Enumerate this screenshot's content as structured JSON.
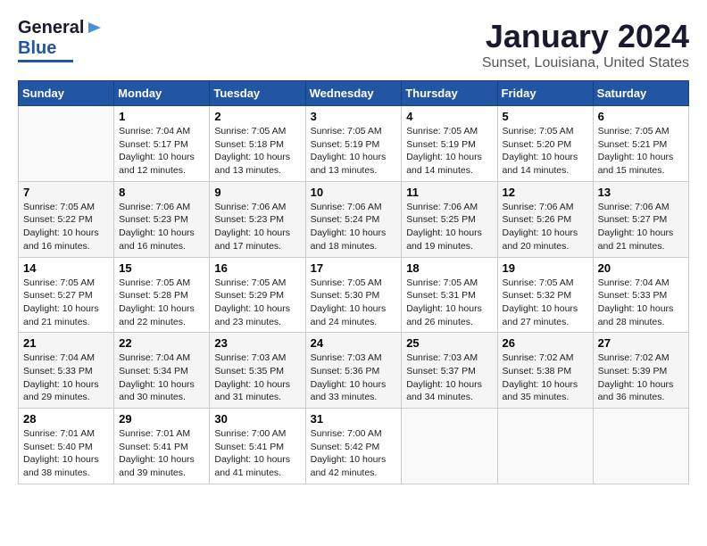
{
  "header": {
    "logo": {
      "line1": "General",
      "line2": "Blue"
    },
    "title": "January 2024",
    "subtitle": "Sunset, Louisiana, United States"
  },
  "weekdays": [
    "Sunday",
    "Monday",
    "Tuesday",
    "Wednesday",
    "Thursday",
    "Friday",
    "Saturday"
  ],
  "weeks": [
    [
      {
        "num": "",
        "sunrise": "",
        "sunset": "",
        "daylight": ""
      },
      {
        "num": "1",
        "sunrise": "Sunrise: 7:04 AM",
        "sunset": "Sunset: 5:17 PM",
        "daylight": "Daylight: 10 hours and 12 minutes."
      },
      {
        "num": "2",
        "sunrise": "Sunrise: 7:05 AM",
        "sunset": "Sunset: 5:18 PM",
        "daylight": "Daylight: 10 hours and 13 minutes."
      },
      {
        "num": "3",
        "sunrise": "Sunrise: 7:05 AM",
        "sunset": "Sunset: 5:19 PM",
        "daylight": "Daylight: 10 hours and 13 minutes."
      },
      {
        "num": "4",
        "sunrise": "Sunrise: 7:05 AM",
        "sunset": "Sunset: 5:19 PM",
        "daylight": "Daylight: 10 hours and 14 minutes."
      },
      {
        "num": "5",
        "sunrise": "Sunrise: 7:05 AM",
        "sunset": "Sunset: 5:20 PM",
        "daylight": "Daylight: 10 hours and 14 minutes."
      },
      {
        "num": "6",
        "sunrise": "Sunrise: 7:05 AM",
        "sunset": "Sunset: 5:21 PM",
        "daylight": "Daylight: 10 hours and 15 minutes."
      }
    ],
    [
      {
        "num": "7",
        "sunrise": "Sunrise: 7:05 AM",
        "sunset": "Sunset: 5:22 PM",
        "daylight": "Daylight: 10 hours and 16 minutes."
      },
      {
        "num": "8",
        "sunrise": "Sunrise: 7:06 AM",
        "sunset": "Sunset: 5:23 PM",
        "daylight": "Daylight: 10 hours and 16 minutes."
      },
      {
        "num": "9",
        "sunrise": "Sunrise: 7:06 AM",
        "sunset": "Sunset: 5:23 PM",
        "daylight": "Daylight: 10 hours and 17 minutes."
      },
      {
        "num": "10",
        "sunrise": "Sunrise: 7:06 AM",
        "sunset": "Sunset: 5:24 PM",
        "daylight": "Daylight: 10 hours and 18 minutes."
      },
      {
        "num": "11",
        "sunrise": "Sunrise: 7:06 AM",
        "sunset": "Sunset: 5:25 PM",
        "daylight": "Daylight: 10 hours and 19 minutes."
      },
      {
        "num": "12",
        "sunrise": "Sunrise: 7:06 AM",
        "sunset": "Sunset: 5:26 PM",
        "daylight": "Daylight: 10 hours and 20 minutes."
      },
      {
        "num": "13",
        "sunrise": "Sunrise: 7:06 AM",
        "sunset": "Sunset: 5:27 PM",
        "daylight": "Daylight: 10 hours and 21 minutes."
      }
    ],
    [
      {
        "num": "14",
        "sunrise": "Sunrise: 7:05 AM",
        "sunset": "Sunset: 5:27 PM",
        "daylight": "Daylight: 10 hours and 21 minutes."
      },
      {
        "num": "15",
        "sunrise": "Sunrise: 7:05 AM",
        "sunset": "Sunset: 5:28 PM",
        "daylight": "Daylight: 10 hours and 22 minutes."
      },
      {
        "num": "16",
        "sunrise": "Sunrise: 7:05 AM",
        "sunset": "Sunset: 5:29 PM",
        "daylight": "Daylight: 10 hours and 23 minutes."
      },
      {
        "num": "17",
        "sunrise": "Sunrise: 7:05 AM",
        "sunset": "Sunset: 5:30 PM",
        "daylight": "Daylight: 10 hours and 24 minutes."
      },
      {
        "num": "18",
        "sunrise": "Sunrise: 7:05 AM",
        "sunset": "Sunset: 5:31 PM",
        "daylight": "Daylight: 10 hours and 26 minutes."
      },
      {
        "num": "19",
        "sunrise": "Sunrise: 7:05 AM",
        "sunset": "Sunset: 5:32 PM",
        "daylight": "Daylight: 10 hours and 27 minutes."
      },
      {
        "num": "20",
        "sunrise": "Sunrise: 7:04 AM",
        "sunset": "Sunset: 5:33 PM",
        "daylight": "Daylight: 10 hours and 28 minutes."
      }
    ],
    [
      {
        "num": "21",
        "sunrise": "Sunrise: 7:04 AM",
        "sunset": "Sunset: 5:33 PM",
        "daylight": "Daylight: 10 hours and 29 minutes."
      },
      {
        "num": "22",
        "sunrise": "Sunrise: 7:04 AM",
        "sunset": "Sunset: 5:34 PM",
        "daylight": "Daylight: 10 hours and 30 minutes."
      },
      {
        "num": "23",
        "sunrise": "Sunrise: 7:03 AM",
        "sunset": "Sunset: 5:35 PM",
        "daylight": "Daylight: 10 hours and 31 minutes."
      },
      {
        "num": "24",
        "sunrise": "Sunrise: 7:03 AM",
        "sunset": "Sunset: 5:36 PM",
        "daylight": "Daylight: 10 hours and 33 minutes."
      },
      {
        "num": "25",
        "sunrise": "Sunrise: 7:03 AM",
        "sunset": "Sunset: 5:37 PM",
        "daylight": "Daylight: 10 hours and 34 minutes."
      },
      {
        "num": "26",
        "sunrise": "Sunrise: 7:02 AM",
        "sunset": "Sunset: 5:38 PM",
        "daylight": "Daylight: 10 hours and 35 minutes."
      },
      {
        "num": "27",
        "sunrise": "Sunrise: 7:02 AM",
        "sunset": "Sunset: 5:39 PM",
        "daylight": "Daylight: 10 hours and 36 minutes."
      }
    ],
    [
      {
        "num": "28",
        "sunrise": "Sunrise: 7:01 AM",
        "sunset": "Sunset: 5:40 PM",
        "daylight": "Daylight: 10 hours and 38 minutes."
      },
      {
        "num": "29",
        "sunrise": "Sunrise: 7:01 AM",
        "sunset": "Sunset: 5:41 PM",
        "daylight": "Daylight: 10 hours and 39 minutes."
      },
      {
        "num": "30",
        "sunrise": "Sunrise: 7:00 AM",
        "sunset": "Sunset: 5:41 PM",
        "daylight": "Daylight: 10 hours and 41 minutes."
      },
      {
        "num": "31",
        "sunrise": "Sunrise: 7:00 AM",
        "sunset": "Sunset: 5:42 PM",
        "daylight": "Daylight: 10 hours and 42 minutes."
      },
      {
        "num": "",
        "sunrise": "",
        "sunset": "",
        "daylight": ""
      },
      {
        "num": "",
        "sunrise": "",
        "sunset": "",
        "daylight": ""
      },
      {
        "num": "",
        "sunrise": "",
        "sunset": "",
        "daylight": ""
      }
    ]
  ]
}
